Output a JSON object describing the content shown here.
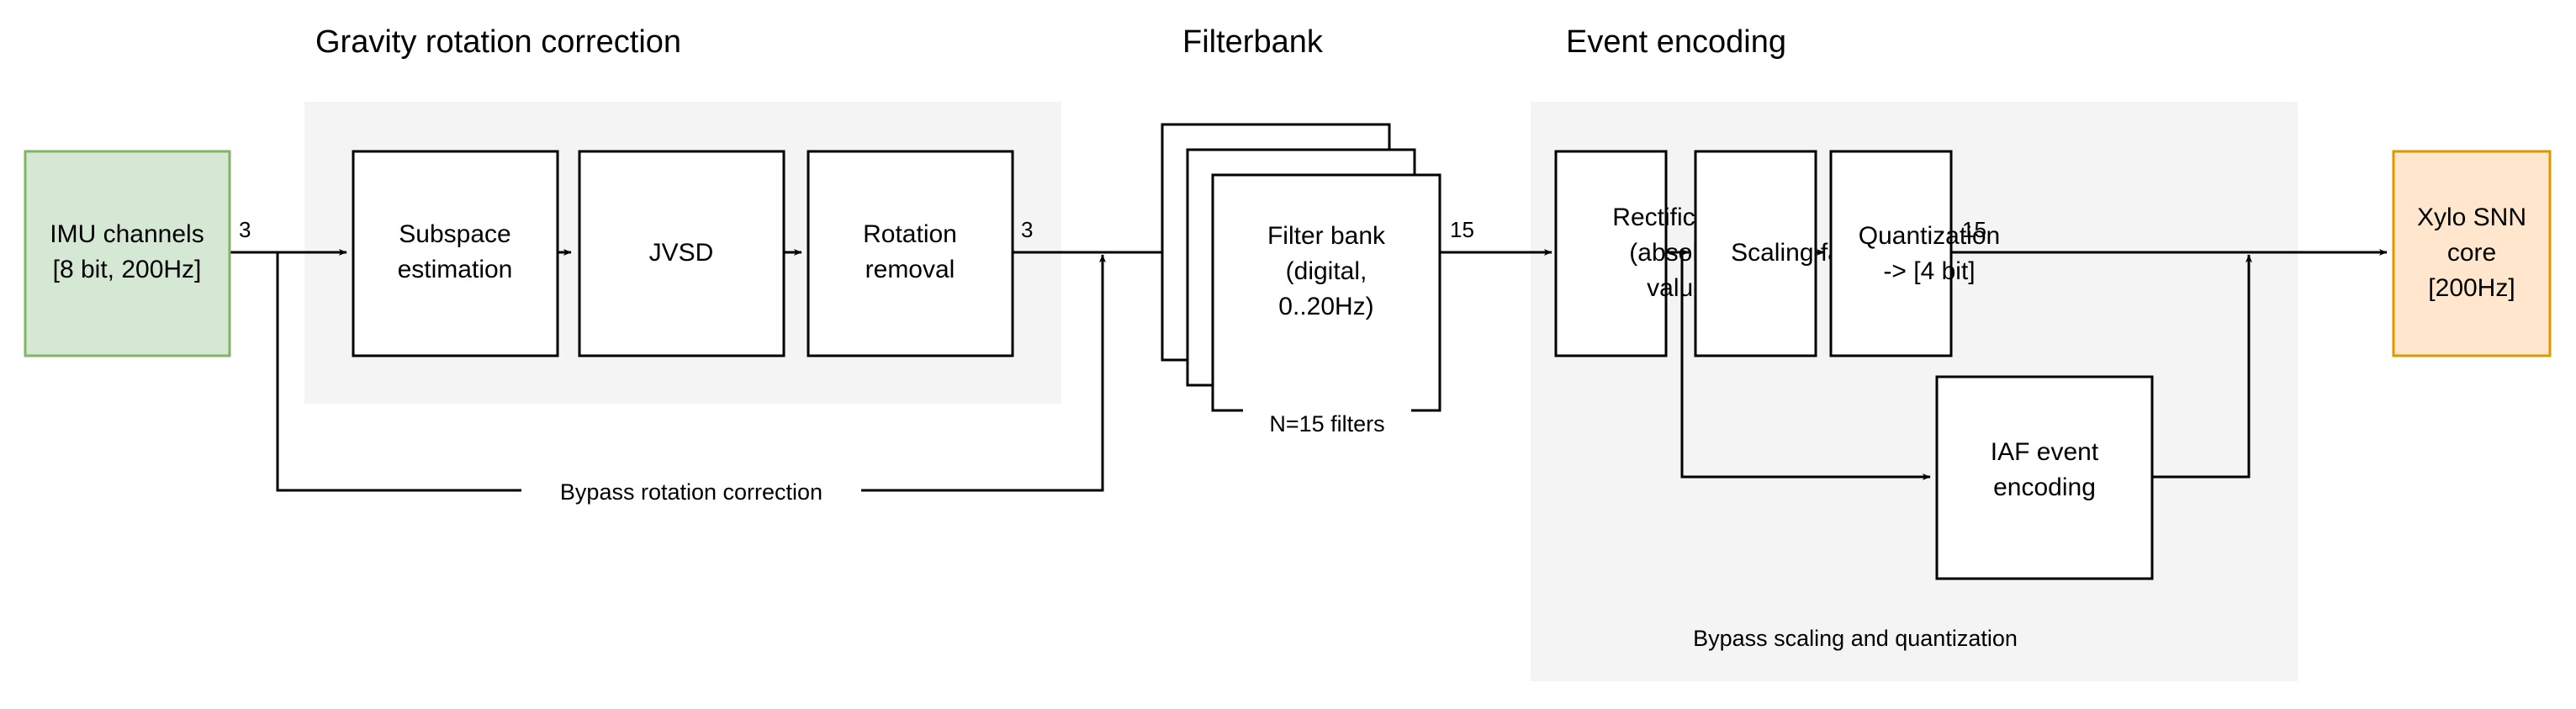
{
  "diagram": {
    "title_gravity": "Gravity rotation correction",
    "title_filterbank": "Filterbank",
    "title_event_encoding": "Event encoding",
    "colors": {
      "group_background": "#f4f4f4",
      "input_fill": "#d5e8d4",
      "input_stroke": "#82b366",
      "output_fill": "#ffe6cc",
      "output_stroke": "#d79b00",
      "box_fill": "#ffffff",
      "box_stroke": "#000000",
      "line": "#000000"
    }
  },
  "nodes": {
    "imu": {
      "line1": "IMU channels",
      "line2": "[8 bit, 200Hz]"
    },
    "subspace": {
      "line1": "Subspace",
      "line2": "estimation"
    },
    "jvsd": {
      "line1": "JVSD"
    },
    "rotation_removal": {
      "line1": "Rotation",
      "line2": "removal"
    },
    "filter_bank": {
      "line1": "Filter bank",
      "line2": "(digital,",
      "line3": "0..20Hz)"
    },
    "rectification": {
      "line1": "Rectification",
      "line2": "(absolute",
      "line3": "value)"
    },
    "scaling_factor": {
      "line1": "Scaling factor"
    },
    "quantization": {
      "line1": "Quantization",
      "line2": "-> [4 bit]"
    },
    "iaf_event_encoding": {
      "line1": "IAF event",
      "line2": "encoding"
    },
    "xylo": {
      "line1": "Xylo SNN",
      "line2": "core",
      "line3": "[200Hz]"
    }
  },
  "edge_labels": {
    "imu_out": "3",
    "rotation_out": "3",
    "filterbank_out": "15",
    "quantization_out": "15"
  },
  "captions": {
    "n_filters": "N=15 filters",
    "bypass_rotation": "Bypass rotation correction",
    "bypass_scaling": "Bypass scaling and quantization"
  }
}
